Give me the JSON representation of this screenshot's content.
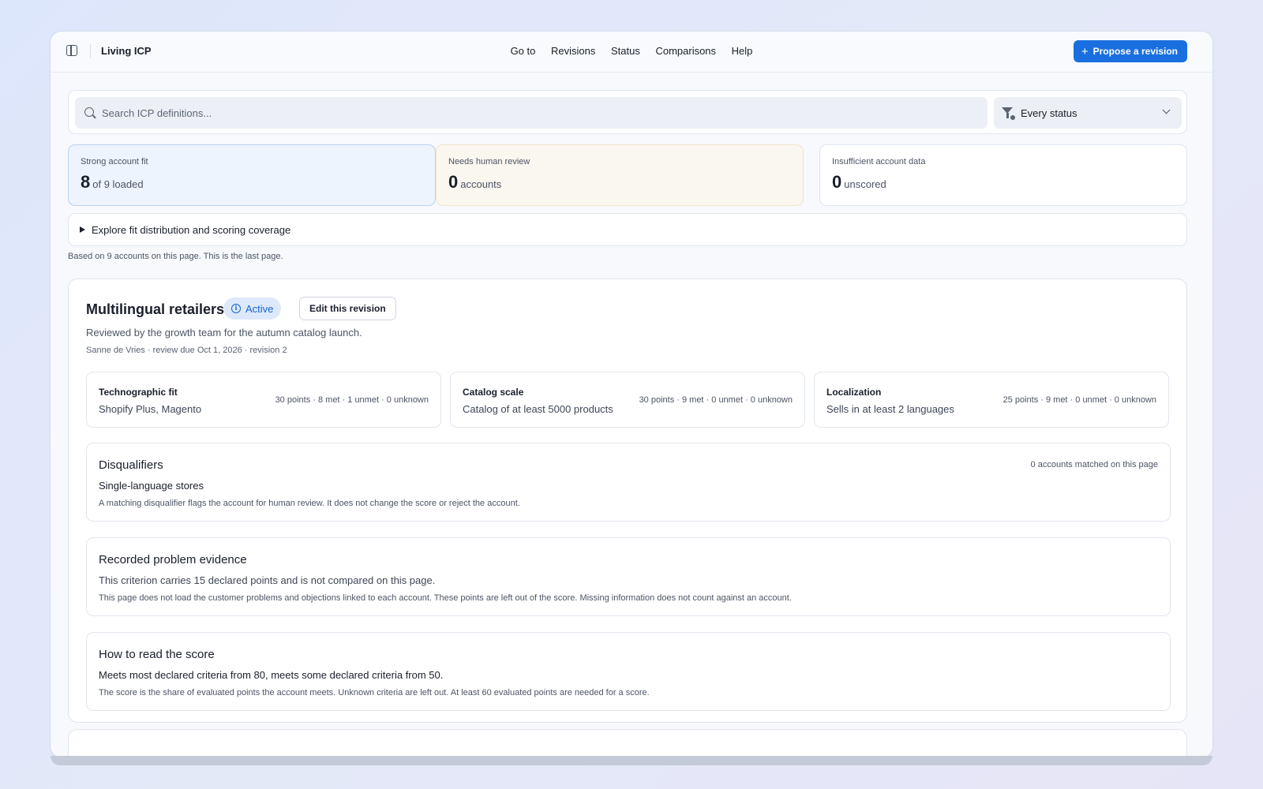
{
  "header": {
    "app_title": "Living ICP",
    "nav": [
      "Go to",
      "Revisions",
      "Status",
      "Comparisons",
      "Help"
    ],
    "propose_label": "Propose a revision"
  },
  "search": {
    "placeholder": "Search ICP definitions...",
    "status_filter": "Every status"
  },
  "stats": [
    {
      "label": "Strong account fit",
      "value": "8",
      "suffix": "of 9 loaded"
    },
    {
      "label": "Needs human review",
      "value": "0",
      "suffix": "accounts"
    },
    {
      "label": "Insufficient account data",
      "value": "0",
      "suffix": "unscored"
    }
  ],
  "explore_label": "Explore fit distribution and scoring coverage",
  "based_on": "Based on 9 accounts on this page. This is the last page.",
  "revision": {
    "title": "Multilingual retailers",
    "badge": "Active",
    "edit_label": "Edit this revision",
    "description": "Reviewed by the growth team for the autumn catalog launch.",
    "meta": "Sanne de Vries · review due Oct 1, 2026 · revision 2",
    "criteria": [
      {
        "name": "Technographic fit",
        "value": "Shopify Plus, Magento",
        "stats": "30 points · 8 met · 1 unmet · 0 unknown"
      },
      {
        "name": "Catalog scale",
        "value": "Catalog of at least 5000 products",
        "stats": "30 points · 9 met · 0 unmet · 0 unknown"
      },
      {
        "name": "Localization",
        "value": "Sells in at least 2 languages",
        "stats": "25 points · 9 met · 0 unmet · 0 unknown"
      }
    ],
    "disqualifiers": {
      "title": "Disqualifiers",
      "matched": "0 accounts matched on this page",
      "item": "Single-language stores",
      "note": "A matching disqualifier flags the account for human review. It does not change the score or reject the account."
    },
    "evidence": {
      "title": "Recorded problem evidence",
      "line": "This criterion carries 15 declared points and is not compared on this page.",
      "note": "This page does not load the customer problems and objections linked to each account. These points are left out of the score. Missing information does not count against an account."
    },
    "score": {
      "title": "How to read the score",
      "line": "Meets most declared criteria from 80, meets some declared criteria from 50.",
      "note": "The score is the share of evaluated points the account meets. Unknown criteria are left out. At least 60 evaluated points are needed for a score."
    }
  },
  "colors": {
    "accent": "#1a6fe0",
    "strong_fit_bg": "#edf4fd",
    "review_bg": "#faf7f0"
  }
}
